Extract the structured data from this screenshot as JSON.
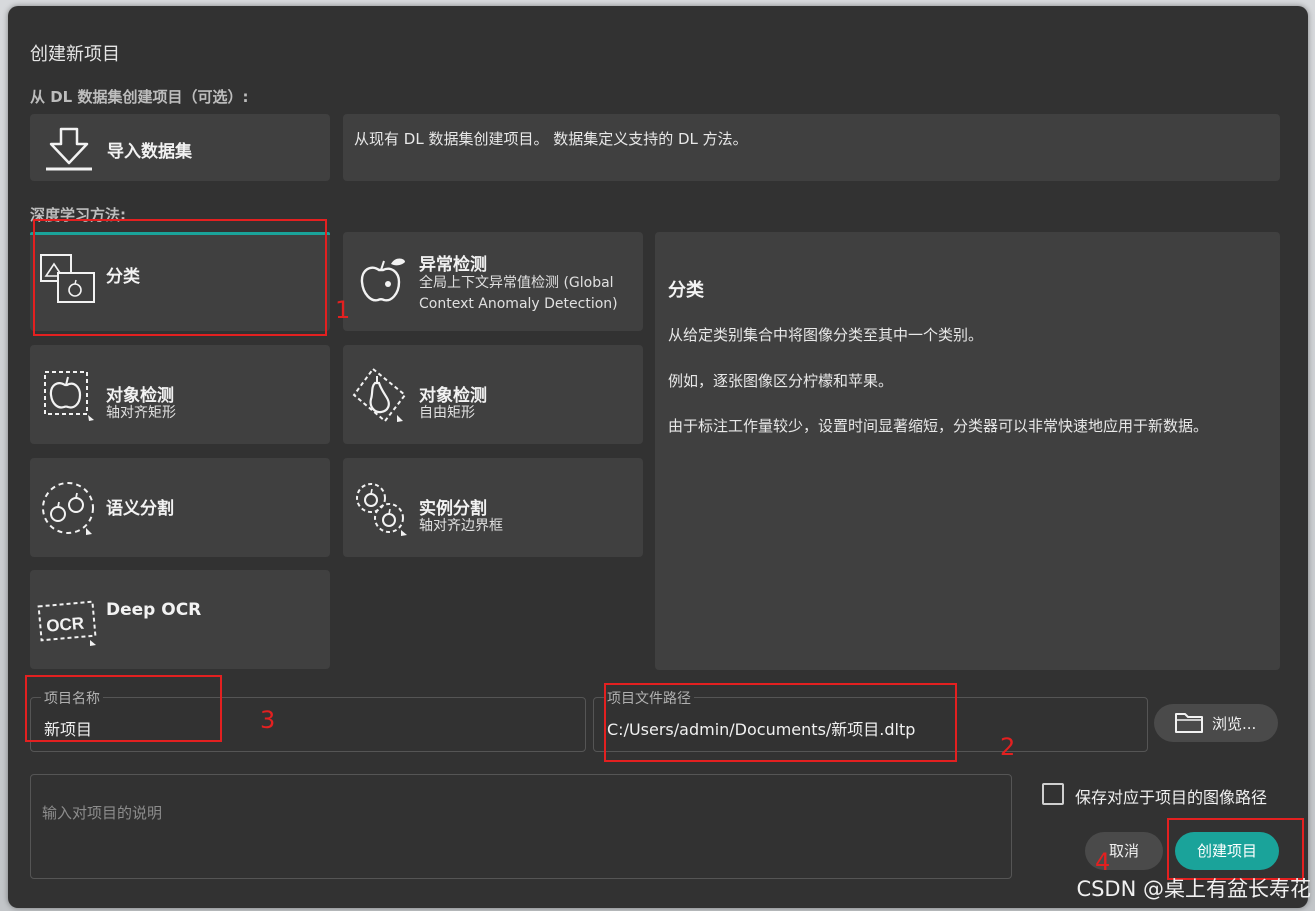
{
  "dialog": {
    "title": "创建新项目",
    "dataset_section": "从 DL 数据集创建项目（可选）:",
    "import_label": "导入数据集",
    "import_desc": "从现有 DL 数据集创建项目。 数据集定义支持的 DL 方法。",
    "methods_section": "深度学习方法:"
  },
  "methods": [
    {
      "label": "分类",
      "sub": "",
      "icon": "classification-icon",
      "selected": true
    },
    {
      "label": "异常检测",
      "sub": "全局上下文异常值检测 (Global Context Anomaly Detection)",
      "icon": "anomaly-apple-icon"
    },
    {
      "label": "对象检测",
      "sub": "轴对齐矩形",
      "icon": "object-detection-axis-icon"
    },
    {
      "label": "对象检测",
      "sub": "自由矩形",
      "icon": "object-detection-free-icon"
    },
    {
      "label": "语义分割",
      "sub": "",
      "icon": "semantic-segmentation-icon"
    },
    {
      "label": "实例分割",
      "sub": "轴对齐边界框",
      "icon": "instance-segmentation-icon"
    },
    {
      "label": "Deep OCR",
      "sub": "",
      "icon": "ocr-icon"
    }
  ],
  "detail": {
    "title": "分类",
    "p1": "从给定类别集合中将图像分类至其中一个类别。",
    "p2": "例如，逐张图像区分柠檬和苹果。",
    "p3": "由于标注工作量较少，设置时间显著缩短，分类器可以非常快速地应用于新数据。"
  },
  "project_name": {
    "legend": "项目名称",
    "value": "新项目"
  },
  "project_path": {
    "legend": "项目文件路径",
    "value": "C:/Users/admin/Documents/新项目.dltp"
  },
  "browse_label": "浏览...",
  "description_placeholder": "输入对项目的说明",
  "save_paths_label": "保存对应于项目的图像路径",
  "cancel_label": "取消",
  "create_label": "创建项目",
  "annotations": [
    "1",
    "2",
    "3",
    "4"
  ],
  "watermark": "CSDN @桌上有盆长寿花",
  "colors": {
    "accent": "#1aa39a",
    "annotation": "#e32020",
    "panel": "#404040",
    "dialog": "#323232"
  }
}
